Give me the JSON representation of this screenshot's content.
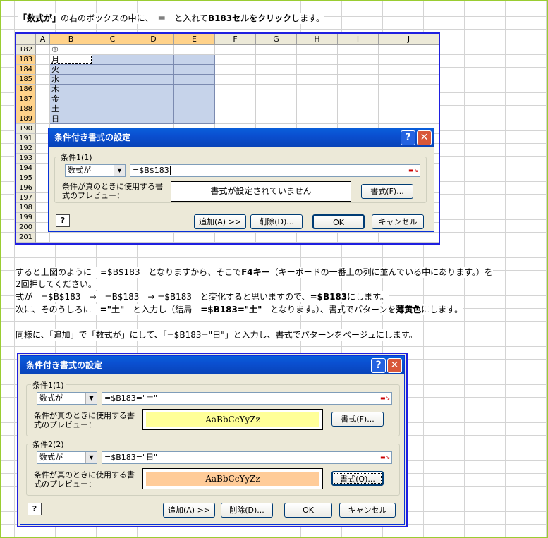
{
  "instruction1": {
    "part1": "「数式が」",
    "part2": "の右のボックスの中に、　＝　と入れて",
    "part3": "B183セルをクリック",
    "part4": "します。"
  },
  "sheet": {
    "columns": [
      "A",
      "B",
      "C",
      "D",
      "E",
      "F",
      "G",
      "H",
      "I",
      "J"
    ],
    "rows": [
      "182",
      "183",
      "184",
      "185",
      "186",
      "187",
      "188",
      "189",
      "190",
      "191",
      "192",
      "193",
      "194",
      "195",
      "196",
      "197",
      "198",
      "199",
      "200",
      "201"
    ],
    "marker": "③",
    "weekdays": [
      "月",
      "火",
      "水",
      "木",
      "金",
      "土",
      "日"
    ]
  },
  "dialog1": {
    "title": "条件付き書式の設定",
    "group_label": "条件1(1)",
    "combo_value": "数式が",
    "formula_value": "=$B$183",
    "preview_label_line1": "条件が真のときに使用する書",
    "preview_label_line2": "式のプレビュー：",
    "preview_text": "書式が設定されていません",
    "format_button": "書式(F)...",
    "add_button": "追加(A) >>",
    "delete_button": "削除(D)...",
    "ok_button": "OK",
    "cancel_button": "キャンセル"
  },
  "paragraphs": {
    "p1_a": "すると上図のように　=$B$183　となりますから、そこで",
    "p1_b": "F4キー",
    "p1_c": "（キーボードの一番上の列に並んでいる中にあります。）を",
    "p1_d": "2回押してください。",
    "p2_a": "式が　=$B$183　→　=B$183　→ =$B183　と変化すると思いますので、",
    "p2_b": "=$B183",
    "p2_c": "にします。",
    "p3_a": "次に、そのうしろに　",
    "p3_b": "=\"土\"",
    "p3_c": "　と入力し（結局　",
    "p3_d": "=$B183=\"土\"",
    "p3_e": "　となります。）、書式でパターンを",
    "p3_f": "薄黄色",
    "p3_g": "にします。",
    "p4": "同様に、「追加」で「数式が」にして、「=$B183=\"日\"」と入力し、書式でパターンをベージュにします。"
  },
  "dialog2": {
    "title": "条件付き書式の設定",
    "group1_label": "条件1(1)",
    "group2_label": "条件2(2)",
    "combo1_value": "数式が",
    "combo2_value": "数式が",
    "formula1_value": "=$B183=\"土\"",
    "formula2_value": "=$B183=\"日\"",
    "preview_label_line1": "条件が真のときに使用する書",
    "preview_label_line2": "式のプレビュー：",
    "preview1_text": "AaBbCcYyZz",
    "preview2_text": "AaBbCcYyZz",
    "format1_button": "書式(F)...",
    "format2_button": "書式(O)...",
    "add_button": "追加(A) >>",
    "delete_button": "削除(D)...",
    "ok_button": "OK",
    "cancel_button": "キャンセル"
  },
  "colors": {
    "preview_yellow": "#ffff99",
    "preview_beige": "#ffcc99",
    "frame_blue": "#1f1fe0",
    "page_border": "#9acd32"
  }
}
